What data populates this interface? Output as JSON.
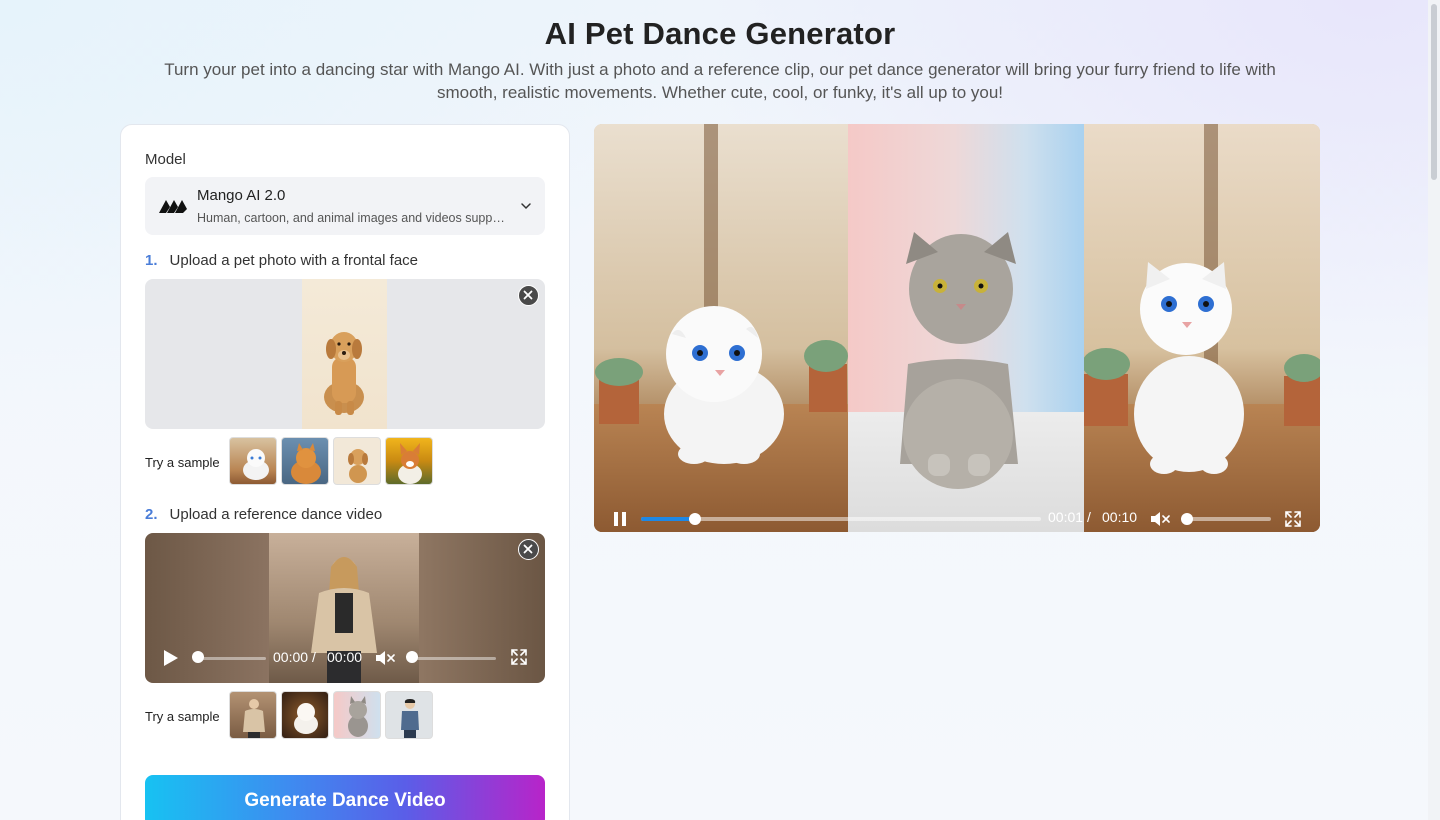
{
  "page": {
    "title": "AI Pet Dance Generator",
    "subtitle": "Turn your pet into a dancing star with Mango AI. With just a photo and a reference clip, our pet dance generator will bring your furry friend to life with smooth, realistic movements. Whether cute, cool, or funky, it's all up to you!"
  },
  "model": {
    "label": "Model",
    "name": "Mango AI 2.0",
    "description": "Human, cartoon, and animal images and videos supported"
  },
  "step1": {
    "number": "1.",
    "label": "Upload a pet photo with a frontal face",
    "try_label": "Try a sample",
    "samples": [
      "white-kitten-sample",
      "orange-cat-sample",
      "golden-retriever-sample",
      "corgi-sunflower-sample"
    ]
  },
  "step2": {
    "number": "2.",
    "label": "Upload a reference dance video",
    "try_label": "Try a sample",
    "current_time": "00:00",
    "separator": "/",
    "duration": "00:00",
    "progress": 0,
    "volume": 0,
    "samples": [
      "woman-jacket-sample",
      "white-dog-sample",
      "cat-pink-sample",
      "man-denim-sample"
    ]
  },
  "generate": {
    "label": "Generate Dance Video"
  },
  "preview": {
    "current_time": "00:01",
    "separator": "/",
    "duration": "00:10",
    "progress": 0.135,
    "volume": 0,
    "state": "playing"
  },
  "colors": {
    "accent": "#4a7dd8",
    "progress": "#1e88e5",
    "button_start": "#17c2f2",
    "button_end": "#b824c9"
  }
}
